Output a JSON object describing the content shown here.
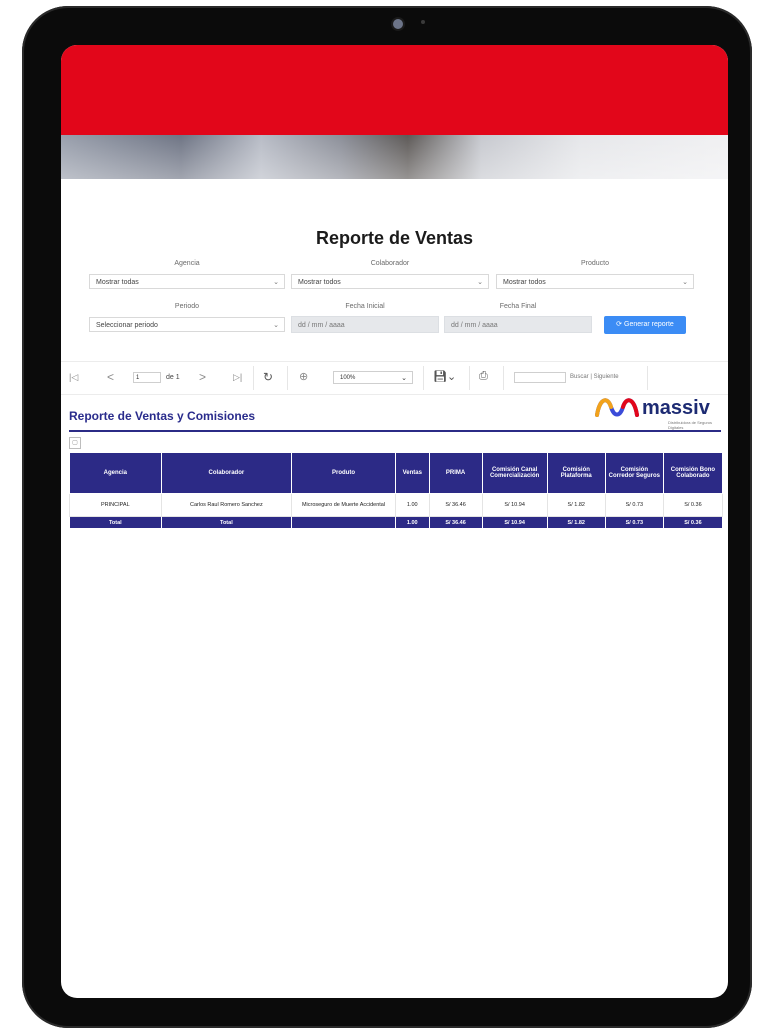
{
  "page": {
    "title": "Reporte de Ventas"
  },
  "filters": {
    "agencia": {
      "label": "Agencia",
      "value": "Mostrar todas"
    },
    "colaborador": {
      "label": "Colaborador",
      "value": "Mostrar todos"
    },
    "producto": {
      "label": "Producto",
      "value": "Mostrar todos"
    },
    "periodo": {
      "label": "Periodo",
      "value": "Seleccionar periodo"
    },
    "fecha_inicial": {
      "label": "Fecha Inicial",
      "placeholder": "dd / mm / aaaa"
    },
    "fecha_final": {
      "label": "Fecha Final",
      "placeholder": "dd / mm / aaaa"
    },
    "generate_label": "Generar reporte"
  },
  "toolbar": {
    "page_value": "1",
    "of_label": "de 1",
    "zoom_value": "100%",
    "find_label": "Buscar",
    "next_label": "Siguiente",
    "icons": [
      "first-page-icon",
      "prev-page-icon",
      "next-page-icon",
      "last-page-icon",
      "refresh-icon",
      "zoom-icon",
      "save-icon",
      "print-icon"
    ]
  },
  "report": {
    "title": "Reporte de Ventas y Comisiones",
    "logo_text": "massiv",
    "logo_tagline": "Distribuidora de Seguros Digitales",
    "columns": [
      "Agencia",
      "Colaborador",
      "Produto",
      "Ventas",
      "PRIMA",
      "Comisión Canal Comercialización",
      "Comisión Plataforma",
      "Comisión Corredor Seguros",
      "Comisión Bono Colaborado"
    ],
    "rows": [
      [
        "PRINCIPAL",
        "Carlos Raul Romero Sanchez",
        "Microseguro de Muerte Accidental",
        "1.00",
        "S/ 36.46",
        "S/ 10.94",
        "S/ 1.82",
        "S/ 0.73",
        "S/ 0.36"
      ]
    ],
    "total_row": [
      "Total",
      "Total",
      "",
      "1.00",
      "S/ 36.46",
      "S/ 10.94",
      "S/ 1.82",
      "S/ 0.73",
      "S/ 0.36"
    ]
  },
  "colors": {
    "brand_red": "#e2061a",
    "table_header": "#2c2a86",
    "button_blue": "#3b8cf5"
  }
}
